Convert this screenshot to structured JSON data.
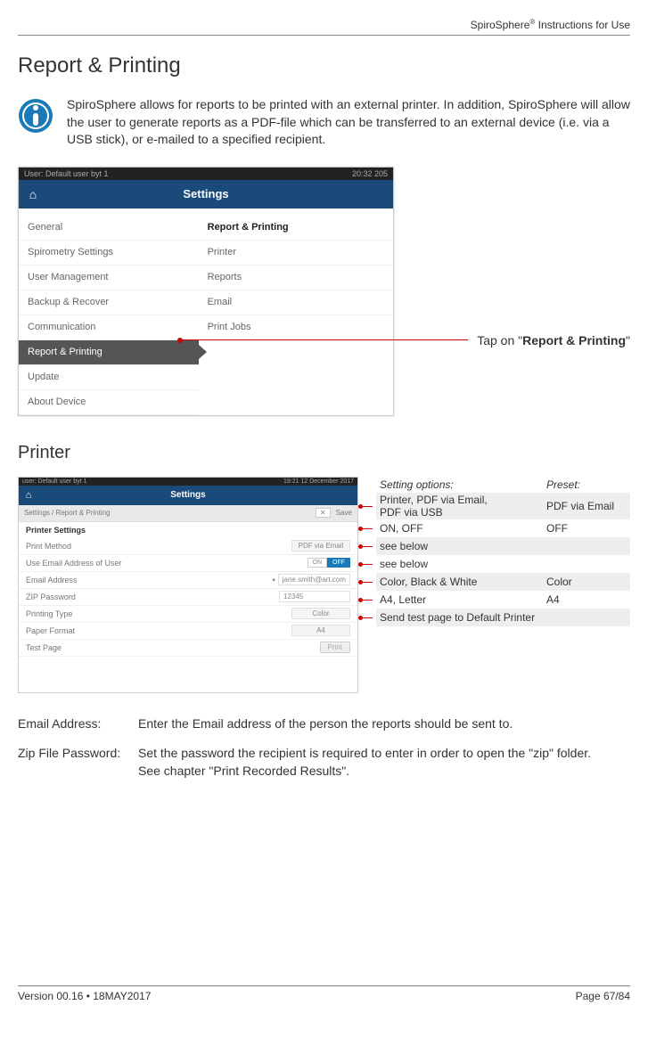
{
  "doc_header": "SpiroSphere® Instructions for Use",
  "heading": "Report & Printing",
  "intro": "SpiroSphere allows for reports to be printed with an external printer. In addition, SpiroSphere will allow the user to generate reports as a PDF-file which can be transferred to an external device (i.e. via a USB stick), or e-mailed to a specified recipient.",
  "callout_tap_prefix": "Tap on \"",
  "callout_tap_bold": "Report & Printing",
  "callout_tap_suffix": "\"",
  "shot1": {
    "status_user": "User: Default user byt 1",
    "status_time": "20:32 205",
    "title": "Settings",
    "left": [
      "General",
      "Spirometry Settings",
      "User Management",
      "Backup & Recover",
      "Communication",
      "Report & Printing",
      "Update",
      "About Device"
    ],
    "right": [
      "Report & Printing",
      "Printer",
      "Reports",
      "Email",
      "Print Jobs"
    ]
  },
  "printer_heading": "Printer",
  "shot2": {
    "status_user": "user: Default user byt 1",
    "status_time": "19:21 12 December 2017",
    "title": "Settings",
    "breadcrumb": "Settings / Report & Printing",
    "breadcrumb_x": "✕",
    "breadcrumb_save": "Save",
    "section": "Printer Settings",
    "rows": [
      {
        "label": "Print Method",
        "val": "PDF via Email",
        "kind": "select"
      },
      {
        "label": "Use Email Address of User",
        "on": "ON",
        "off": "OFF",
        "kind": "toggle"
      },
      {
        "label": "Email Address",
        "val": "jane.smith@art.com",
        "kind": "input",
        "bullet": "•"
      },
      {
        "label": "ZIP Password",
        "val": "12345",
        "kind": "input"
      },
      {
        "label": "Printing Type",
        "val": "Color",
        "kind": "select"
      },
      {
        "label": "Paper Format",
        "val": "A4",
        "kind": "select"
      },
      {
        "label": "Test Page",
        "val": "Print",
        "kind": "button"
      }
    ]
  },
  "options": {
    "header_setting": "Setting options:",
    "header_preset": "Preset:",
    "rows": [
      {
        "opt": "Printer, PDF via Email,\nPDF via USB",
        "preset": "PDF via Email",
        "shade": true,
        "lead": true
      },
      {
        "opt": "ON, OFF",
        "preset": "OFF",
        "shade": false,
        "lead": true
      },
      {
        "opt": "see below",
        "preset": "",
        "shade": true,
        "lead": true
      },
      {
        "opt": "see below",
        "preset": "",
        "shade": false,
        "lead": true
      },
      {
        "opt": "Color, Black & White",
        "preset": "Color",
        "shade": true,
        "lead": true
      },
      {
        "opt": "A4, Letter",
        "preset": "A4",
        "shade": false,
        "lead": true
      },
      {
        "opt": "Send test page to Default Printer",
        "preset": "",
        "shade": true,
        "lead": true
      }
    ]
  },
  "definitions": [
    {
      "term": "Email Address:",
      "def": "Enter the Email address of the person the reports should be sent to."
    },
    {
      "term": "Zip File Password:",
      "def": "Set the password the recipient is required to enter in order to open the \"zip\" folder.\nSee chapter \"Print Recorded Results\"."
    }
  ],
  "footer_version": "Version 00.16 • 18MAY2017",
  "footer_page": "Page 67/84"
}
